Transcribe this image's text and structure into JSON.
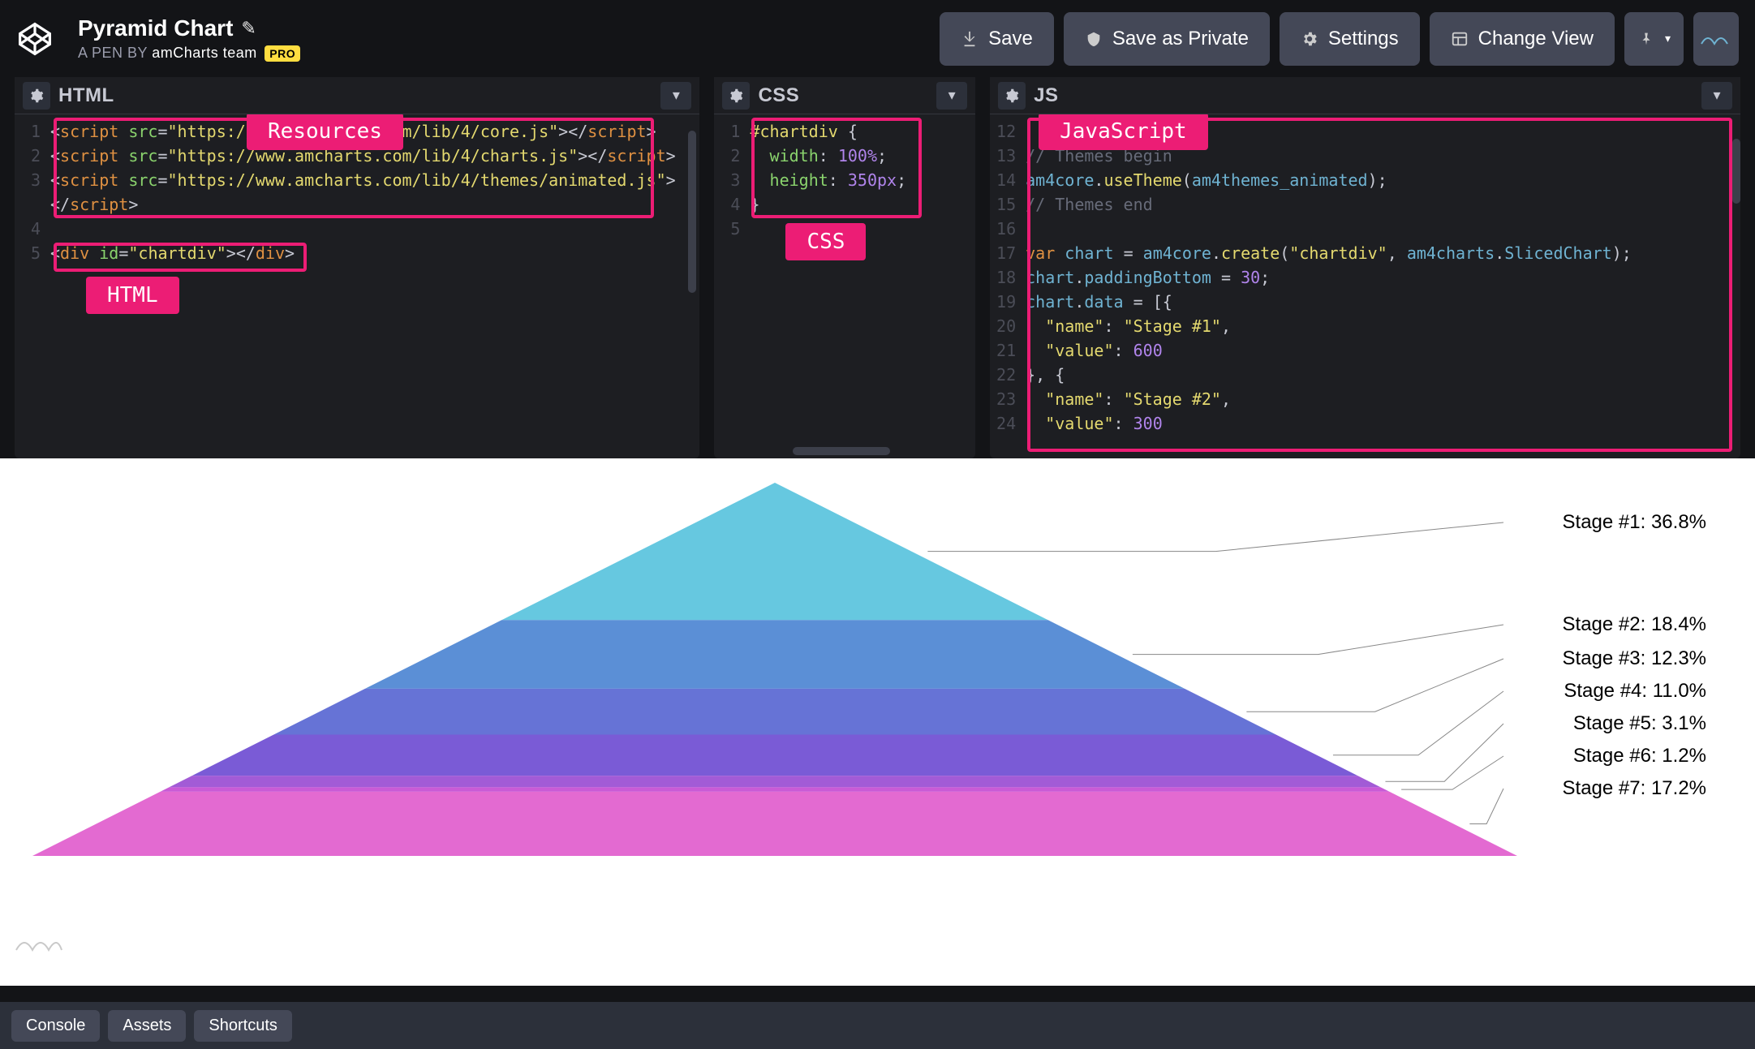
{
  "header": {
    "title": "Pyramid Chart",
    "byline_prefix": "A PEN BY ",
    "author": "amCharts team",
    "pro_badge": "PRO",
    "buttons": {
      "save": "Save",
      "save_private": "Save as Private",
      "settings": "Settings",
      "change_view": "Change View"
    }
  },
  "panels": {
    "html": {
      "title": "HTML"
    },
    "css": {
      "title": "CSS"
    },
    "js": {
      "title": "JS"
    }
  },
  "annotations": {
    "resources": "Resources",
    "html": "HTML",
    "css": "CSS",
    "javascript": "JavaScript"
  },
  "code_html": {
    "l1": "<script src=\"https://www.amcharts.com/lib/4/core.js\"></script>",
    "l2": "<script src=\"https://www.amcharts.com/lib/4/charts.js\"></script>",
    "l3": "<script src=\"https://www.amcharts.com/lib/4/themes/animated.js\">",
    "l3b": "</script>",
    "l5": "<div id=\"chartdiv\"></div>"
  },
  "code_css": {
    "l1": "#chartdiv {",
    "l2": "  width: 100%;",
    "l3": "  height: 350px;",
    "l4": "}"
  },
  "code_js": {
    "l12": "",
    "l13": "// Themes begin",
    "l14": "am4core.useTheme(am4themes_animated);",
    "l15": "// Themes end",
    "l16": "",
    "l17": "var chart = am4core.create(\"chartdiv\", am4charts.SlicedChart);",
    "l18": "chart.paddingBottom = 30;",
    "l19": "chart.data = [{",
    "l20": "  \"name\": \"Stage #1\",",
    "l21": "  \"value\": 600",
    "l22": "}, {",
    "l23": "  \"name\": \"Stage #2\",",
    "l24": "  \"value\": 300"
  },
  "chart_data": {
    "type": "pyramid",
    "title": "Pyramid Chart",
    "series": [
      {
        "name": "Stage #1",
        "percent": 36.8,
        "color": "#66c8e0"
      },
      {
        "name": "Stage #2",
        "percent": 18.4,
        "color": "#5b8fd6"
      },
      {
        "name": "Stage #3",
        "percent": 12.3,
        "color": "#6673d6"
      },
      {
        "name": "Stage #4",
        "percent": 11.0,
        "color": "#7a5bd6"
      },
      {
        "name": "Stage #5",
        "percent": 3.1,
        "color": "#a25bd6"
      },
      {
        "name": "Stage #6",
        "percent": 1.2,
        "color": "#c95bd6"
      },
      {
        "name": "Stage #7",
        "percent": 17.2,
        "color": "#e36ad1"
      }
    ],
    "labels": [
      "Stage #1: 36.8%",
      "Stage #2: 18.4%",
      "Stage #3: 12.3%",
      "Stage #4: 11.0%",
      "Stage #5: 3.1%",
      "Stage #6: 1.2%",
      "Stage #7: 17.2%"
    ]
  },
  "footer": {
    "console": "Console",
    "assets": "Assets",
    "shortcuts": "Shortcuts"
  }
}
